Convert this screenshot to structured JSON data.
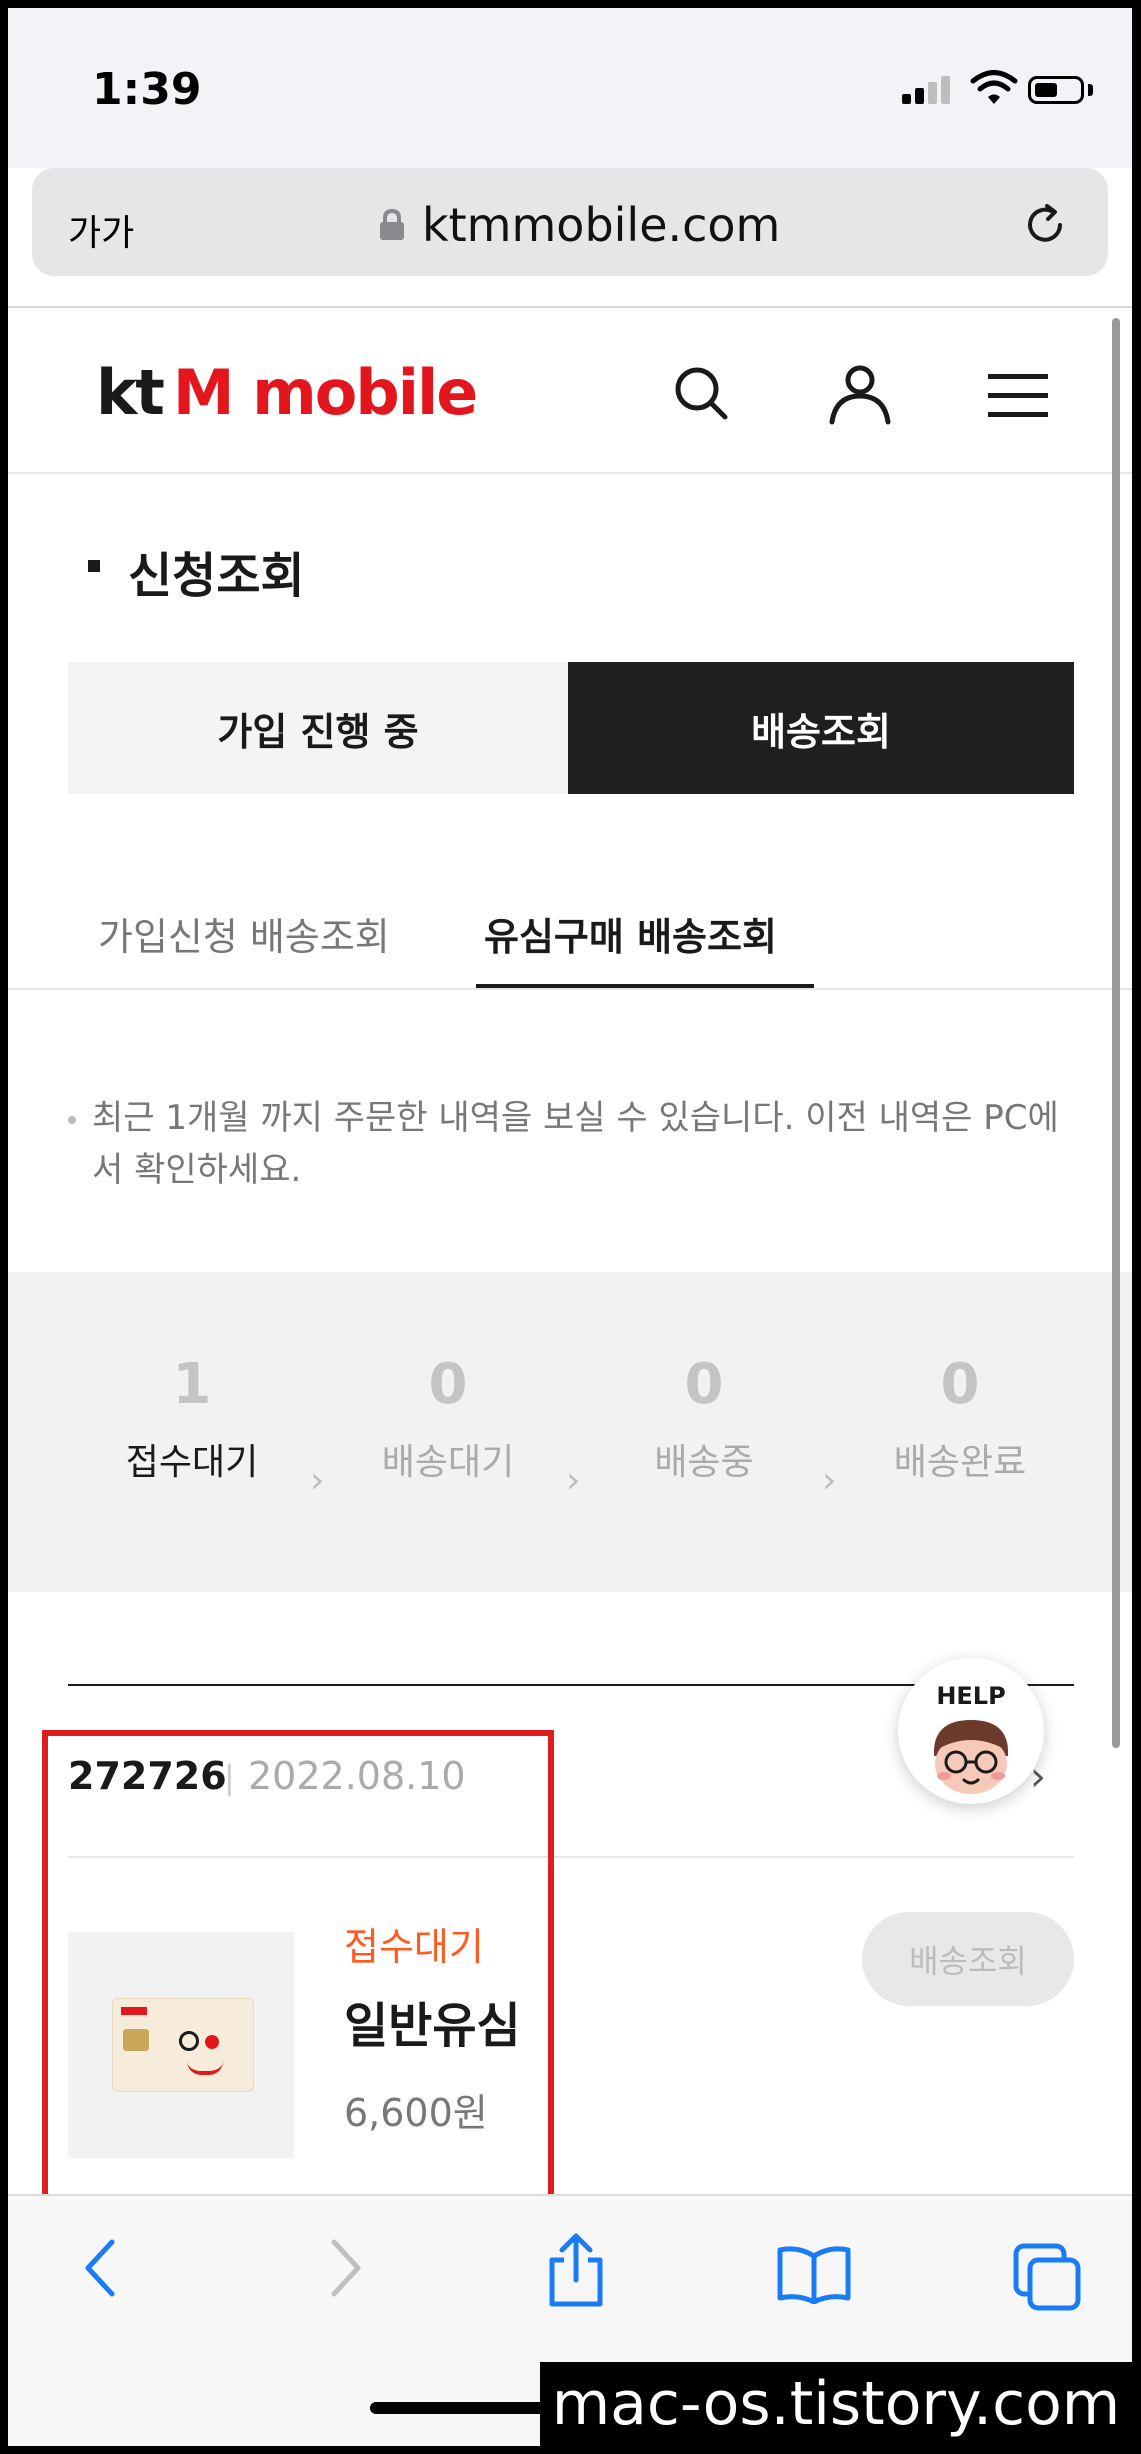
{
  "status_bar": {
    "time": "1:39"
  },
  "browser": {
    "text_size_label": "가가",
    "url": "ktmmobile.com"
  },
  "site": {
    "logo_kt": "kt",
    "logo_m": "M",
    "logo_mobile": "mobile"
  },
  "page": {
    "title": "신청조회",
    "tabs": [
      "가입 진행 중",
      "배송조회"
    ],
    "sub_tabs": [
      "가입신청 배송조회",
      "유심구매 배송조회"
    ],
    "notice": "최근 1개월 까지 주문한 내역을 보실 수 있습니다. 이전 내역은 PC에서 확인하세요."
  },
  "steps": [
    {
      "count": "1",
      "label": "접수대기"
    },
    {
      "count": "0",
      "label": "배송대기"
    },
    {
      "count": "0",
      "label": "배송중"
    },
    {
      "count": "0",
      "label": "배송완료"
    }
  ],
  "order": {
    "number": "272726",
    "date": "2022.08.10",
    "status": "접수대기",
    "product_name": "일반유심",
    "price": "6,600원",
    "track_button": "배송조회"
  },
  "help": {
    "label": "HELP"
  },
  "watermark": "mac-os.tistory.com",
  "colors": {
    "brand_red": "#e4161d",
    "status_orange": "#ff5a1f",
    "highlight_red": "#e21c1c"
  }
}
